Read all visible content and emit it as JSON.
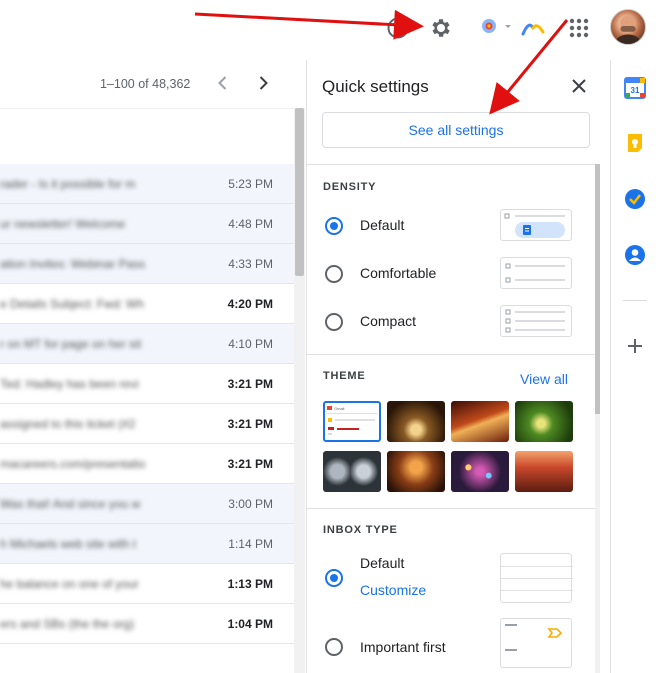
{
  "topbar": {
    "help_icon": "help-icon",
    "settings_icon": "gear-icon",
    "apps_icon": "apps-grid-icon",
    "avatar": "user-avatar"
  },
  "inbox": {
    "pagination": "1–100 of 48,362",
    "rows": [
      {
        "snippet": "rader - Is it possible for m",
        "time": "5:23 PM",
        "unread": false
      },
      {
        "snippet": "ur newsletter! Welcome",
        "time": "4:48 PM",
        "unread": false
      },
      {
        "snippet": "ation Invites: Webinar Pass",
        "time": "4:33 PM",
        "unread": false
      },
      {
        "snippet": "e Details Subject: Fwd: Wh",
        "time": "4:20 PM",
        "unread": true
      },
      {
        "snippet": "r on MT for page on her sit",
        "time": "4:10 PM",
        "unread": false
      },
      {
        "snippet": "Ted: Hadley has been revi",
        "time": "3:21 PM",
        "unread": true
      },
      {
        "snippet": "assigned to this ticket (#2",
        "time": "3:21 PM",
        "unread": true
      },
      {
        "snippet": "macareers.com/presentatio",
        "time": "3:21 PM",
        "unread": true
      },
      {
        "snippet": "Was that! And since you w",
        "time": "3:00 PM",
        "unread": false
      },
      {
        "snippet": "h Michaels web site with t",
        "time": "1:14 PM",
        "unread": false
      },
      {
        "snippet": "he balance on one of your",
        "time": "1:13 PM",
        "unread": true
      },
      {
        "snippet": "ers and SBs (the the org)",
        "time": "1:04 PM",
        "unread": true
      }
    ]
  },
  "quick_settings": {
    "title": "Quick settings",
    "see_all": "See all settings",
    "density": {
      "title": "DENSITY",
      "options": [
        "Default",
        "Comfortable",
        "Compact"
      ],
      "selected": "Default"
    },
    "theme": {
      "title": "THEME",
      "view_all": "View all",
      "thumbnail_label": "Gmail"
    },
    "inbox_type": {
      "title": "INBOX TYPE",
      "options": [
        "Default",
        "Important first"
      ],
      "selected": "Default",
      "customize": "Customize"
    }
  },
  "side_panel": {
    "calendar_day": "31",
    "icons": [
      "calendar-icon",
      "keep-icon",
      "tasks-icon",
      "contacts-icon",
      "add-icon"
    ]
  },
  "colors": {
    "accent": "#1a73e8",
    "annotation_arrow": "#e01010"
  }
}
